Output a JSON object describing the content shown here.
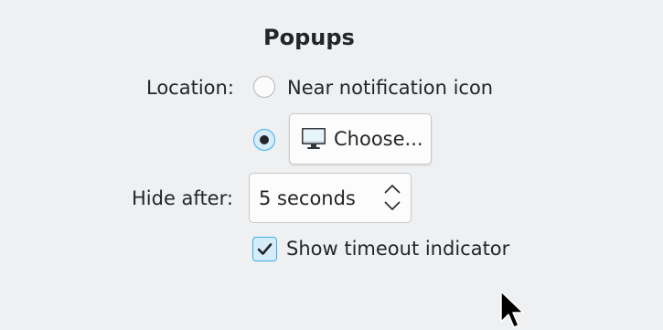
{
  "popups": {
    "title": "Popups",
    "location_label": "Location:",
    "location_options": [
      {
        "label": "Near notification icon",
        "selected": false
      },
      {
        "label": "Choose...",
        "selected": true,
        "icon": "monitor-icon"
      }
    ],
    "hide_after_label": "Hide after:",
    "hide_after_value": "5 seconds",
    "show_timeout_label": "Show timeout indicator",
    "show_timeout_checked": true
  },
  "colors": {
    "window_bg": "#eff0f1",
    "accent": "#3daee9",
    "accent_fill": "#d6ecf8",
    "text": "#232629"
  }
}
